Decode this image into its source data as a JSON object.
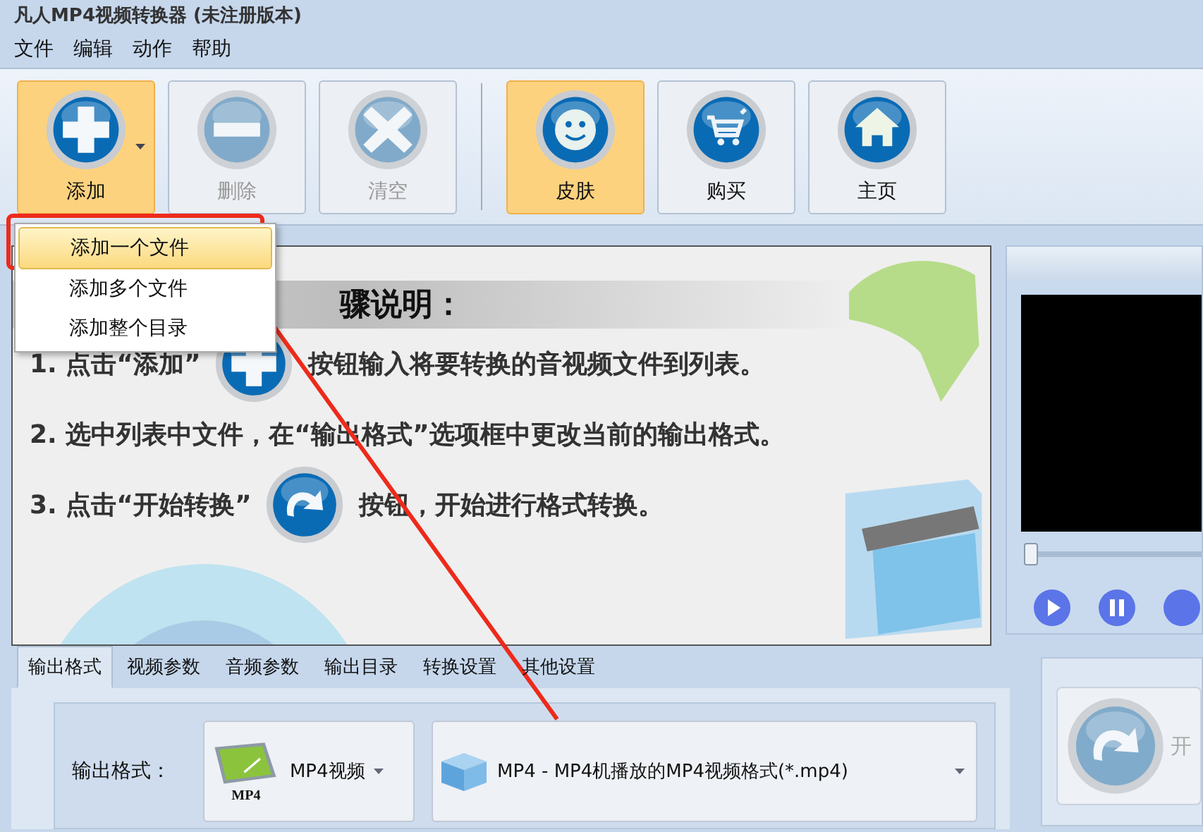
{
  "window": {
    "title": "凡人MP4视频转换器  (未注册版本)"
  },
  "menu_bar": [
    "文件",
    "编辑",
    "动作",
    "帮助"
  ],
  "toolbar": [
    {
      "label": "添加",
      "kind": "plus",
      "highlighted": true,
      "disabled": false,
      "has_dropdown": true
    },
    {
      "label": "删除",
      "kind": "minus",
      "highlighted": false,
      "disabled": true,
      "has_dropdown": false
    },
    {
      "label": "清空",
      "kind": "clear",
      "highlighted": false,
      "disabled": true,
      "has_dropdown": false
    },
    {
      "label": "皮肤",
      "kind": "smile",
      "highlighted": true,
      "disabled": false,
      "has_dropdown": false
    },
    {
      "label": "购买",
      "kind": "cart",
      "highlighted": false,
      "disabled": false,
      "has_dropdown": false
    },
    {
      "label": "主页",
      "kind": "home",
      "highlighted": false,
      "disabled": false,
      "has_dropdown": false
    }
  ],
  "add_menu": [
    {
      "label": "添加一个文件",
      "selected": true
    },
    {
      "label": "添加多个文件",
      "selected": false
    },
    {
      "label": "添加整个目录",
      "selected": false
    }
  ],
  "guide": {
    "title": "骤说明：",
    "steps": [
      {
        "before": "1. 点击“添加”",
        "after": "按钮输入将要转换的音视频文件到列表。"
      },
      {
        "before": "2. 选中列表中文件，在“输出格式”选项框中更改当前的输出格式。"
      },
      {
        "before": "3. 点击“开始转换”",
        "after": "按钮，开始进行格式转换。"
      }
    ]
  },
  "preview": {
    "seek": {
      "level": 0.0
    }
  },
  "tabs": [
    {
      "label": "输出格式",
      "selected": true
    },
    {
      "label": "视频参数",
      "selected": false
    },
    {
      "label": "音频参数",
      "selected": false
    },
    {
      "label": "输出目录",
      "selected": false
    },
    {
      "label": "转换设置",
      "selected": false
    },
    {
      "label": "其他设置",
      "selected": false
    }
  ],
  "output": {
    "label": "输出格式：",
    "device": "MP4视频",
    "device_icon_caption": "MP4",
    "format": "MP4 - MP4机播放的MP4视频格式(*.mp4)"
  },
  "start": {
    "label": "开"
  }
}
